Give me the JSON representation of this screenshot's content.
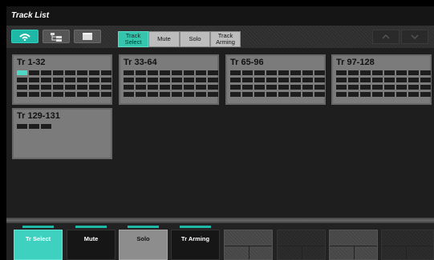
{
  "window": {
    "title": "Track List"
  },
  "toolbar": {
    "view_buttons": [
      {
        "name": "wifi-icon",
        "active": true
      },
      {
        "name": "hierarchy-icon",
        "active": false
      },
      {
        "name": "window-icon",
        "active": false
      }
    ],
    "modes": [
      {
        "label": "Track\nSelect",
        "active": true
      },
      {
        "label": "Mute",
        "active": false
      },
      {
        "label": "Solo",
        "active": false
      },
      {
        "label": "Track\nArming",
        "active": false
      }
    ],
    "nav_icons": [
      "chevron-up-icon",
      "chevron-down-icon"
    ]
  },
  "banks": [
    {
      "label": "Tr 1-32",
      "rows": 4,
      "cols": 8,
      "selected_cell": 0
    },
    {
      "label": "Tr 33-64",
      "rows": 4,
      "cols": 8,
      "selected_cell": -1
    },
    {
      "label": "Tr 65-96",
      "rows": 4,
      "cols": 8,
      "selected_cell": -1
    },
    {
      "label": "Tr 97-128",
      "rows": 4,
      "cols": 8,
      "selected_cell": -1
    },
    {
      "label": "Tr 129-131",
      "rows": 1,
      "cols": 3,
      "selected_cell": -1
    }
  ],
  "function_buttons": [
    {
      "label": "Tr Select",
      "style": "teal",
      "indicator": true
    },
    {
      "label": "Mute",
      "style": "dark",
      "indicator": true
    },
    {
      "label": "Solo",
      "style": "grey",
      "indicator": true
    },
    {
      "label": "Tr Arming",
      "style": "dark",
      "indicator": true
    }
  ],
  "colors": {
    "accent": "#1fb8a6",
    "selected_cell": "#4fd8c4",
    "bank_bg": "#7b7b7b"
  }
}
